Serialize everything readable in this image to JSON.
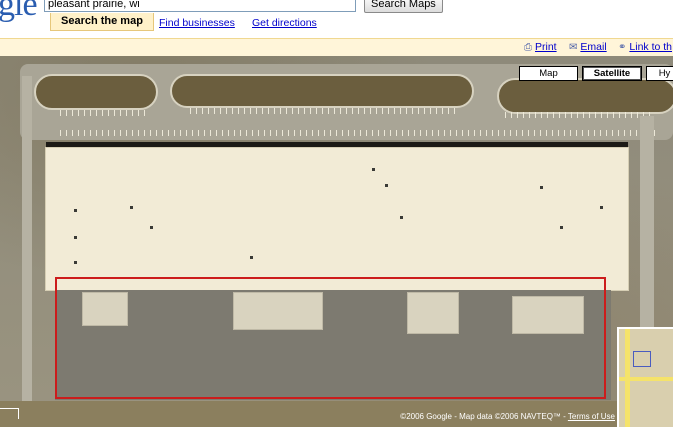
{
  "search": {
    "logo_text": "gle",
    "query": "pleasant prairie, wi",
    "button_label": "Search Maps"
  },
  "tabs": [
    {
      "label": "Search the map",
      "active": true
    },
    {
      "label": "Find businesses",
      "active": false
    },
    {
      "label": "Get directions",
      "active": false
    }
  ],
  "linkbar": {
    "print": "Print",
    "email": "Email",
    "link": "Link to th"
  },
  "map_types": [
    {
      "label": "Map",
      "active": false
    },
    {
      "label": "Satellite",
      "active": true
    },
    {
      "label": "Hy",
      "active": false
    }
  ],
  "attribution": {
    "text": "©2006 Google - Map data ©2006 NAVTEQ™ - ",
    "terms": "Terms of Use"
  },
  "colors": {
    "link": "#0000cc",
    "selection": "#cc1c1c",
    "tab_bg": "#fff1c9"
  },
  "icons": {
    "print": "printer-icon",
    "email": "envelope-icon",
    "link": "chain-link-icon"
  }
}
